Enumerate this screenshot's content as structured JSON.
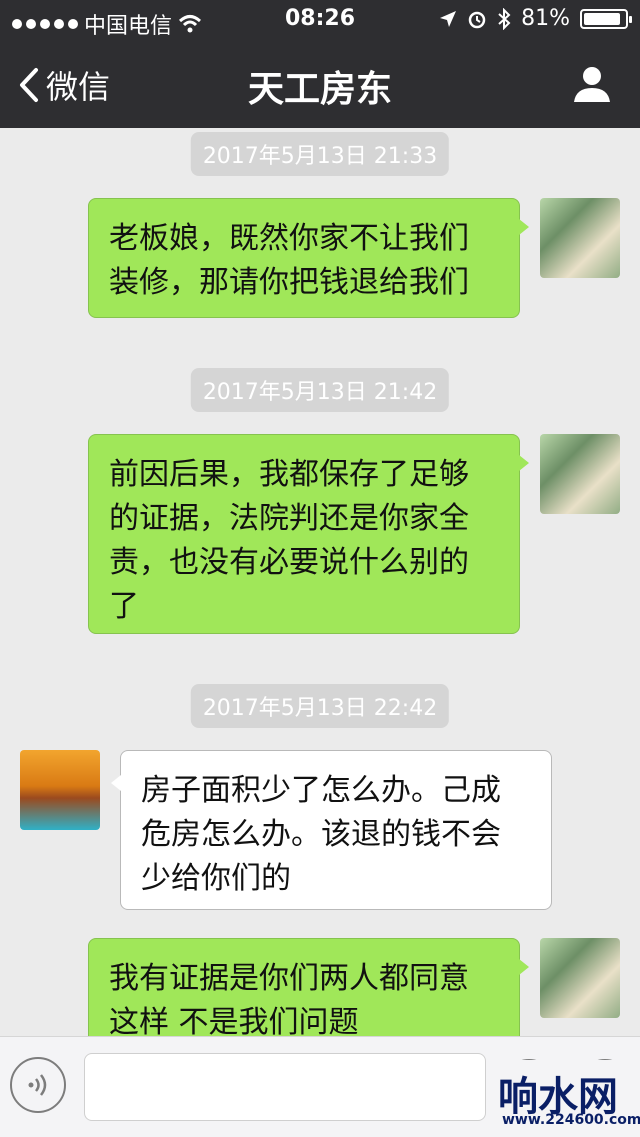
{
  "status_bar": {
    "carrier": "中国电信",
    "time": "08:26",
    "battery": "81%"
  },
  "nav": {
    "back_label": "微信",
    "title": "天工房东"
  },
  "messages": [
    {
      "timestamp": "2017年5月13日 21:33",
      "side": "sent",
      "lines": [
        "老板娘，既然你家不让我们",
        "装修，那请你把钱退给我们"
      ]
    },
    {
      "timestamp": "2017年5月13日 21:42",
      "side": "sent",
      "lines": [
        "前因后果，我都保存了足够",
        "的证据，法院判还是你家全",
        "责，也没有必要说什么别的",
        "了"
      ]
    },
    {
      "timestamp": "2017年5月13日 22:42",
      "side": "received",
      "lines": [
        "房子面积少了怎么办。己成",
        "危房怎么办。该退的钱不会",
        "少给你们的"
      ]
    },
    {
      "timestamp": "",
      "side": "sent",
      "lines": [
        "我有证据是你们两人都同意",
        "这样  不是我们问题"
      ]
    }
  ],
  "watermark": {
    "main": "响水网",
    "url": "www.224600.com"
  },
  "colors": {
    "sent_bubble": "#a0e759",
    "received_bubble": "#ffffff",
    "nav_bg": "#2e2e31",
    "chat_bg": "#ebebeb"
  }
}
